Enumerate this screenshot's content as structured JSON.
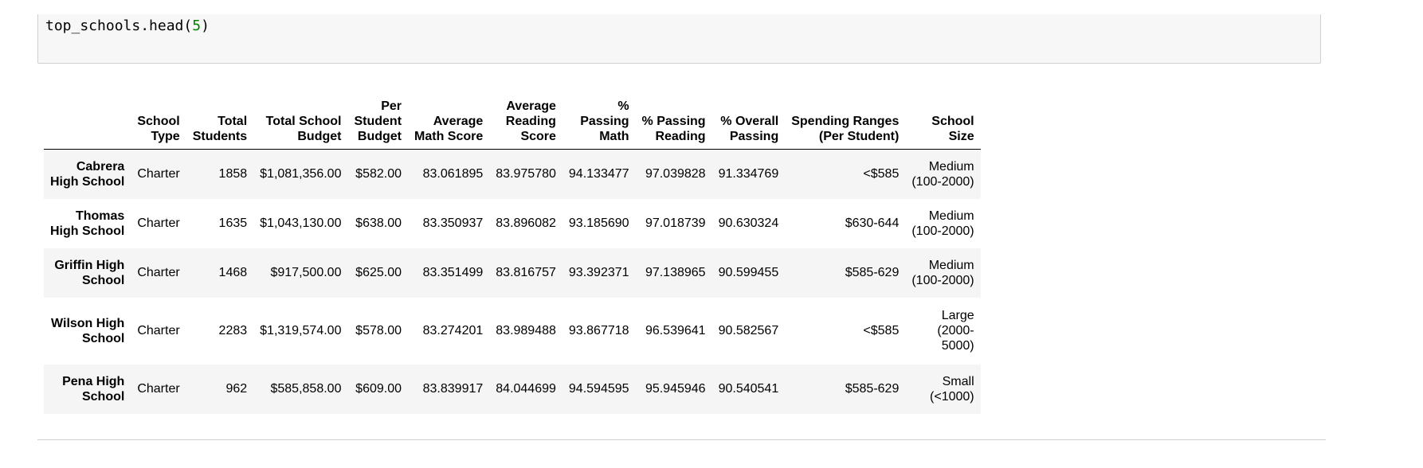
{
  "code": {
    "prefix": "top_schools.head(",
    "arg": "5",
    "suffix": ")"
  },
  "table": {
    "columns": [
      "",
      "School\nType",
      "Total\nStudents",
      "Total School\nBudget",
      "Per\nStudent\nBudget",
      "Average\nMath Score",
      "Average\nReading\nScore",
      "%\nPassing\nMath",
      "% Passing\nReading",
      "% Overall\nPassing",
      "Spending Ranges\n(Per Student)",
      "School\nSize"
    ],
    "rows": [
      {
        "name": "Cabrera\nHigh School",
        "cells": [
          "Charter",
          "1858",
          "$1,081,356.00",
          "$582.00",
          "83.061895",
          "83.975780",
          "94.133477",
          "97.039828",
          "91.334769",
          "<$585",
          "Medium\n(100-2000)"
        ]
      },
      {
        "name": "Thomas\nHigh School",
        "cells": [
          "Charter",
          "1635",
          "$1,043,130.00",
          "$638.00",
          "83.350937",
          "83.896082",
          "93.185690",
          "97.018739",
          "90.630324",
          "$630-644",
          "Medium\n(100-2000)"
        ]
      },
      {
        "name": "Griffin High\nSchool",
        "cells": [
          "Charter",
          "1468",
          "$917,500.00",
          "$625.00",
          "83.351499",
          "83.816757",
          "93.392371",
          "97.138965",
          "90.599455",
          "$585-629",
          "Medium\n(100-2000)"
        ]
      },
      {
        "name": "Wilson High\nSchool",
        "cells": [
          "Charter",
          "2283",
          "$1,319,574.00",
          "$578.00",
          "83.274201",
          "83.989488",
          "93.867718",
          "96.539641",
          "90.582567",
          "<$585",
          "Large\n(2000-\n5000)"
        ]
      },
      {
        "name": "Pena High\nSchool",
        "cells": [
          "Charter",
          "962",
          "$585,858.00",
          "$609.00",
          "83.839917",
          "84.044699",
          "94.594595",
          "95.945946",
          "90.540541",
          "$585-629",
          "Small\n(<1000)"
        ]
      }
    ]
  }
}
